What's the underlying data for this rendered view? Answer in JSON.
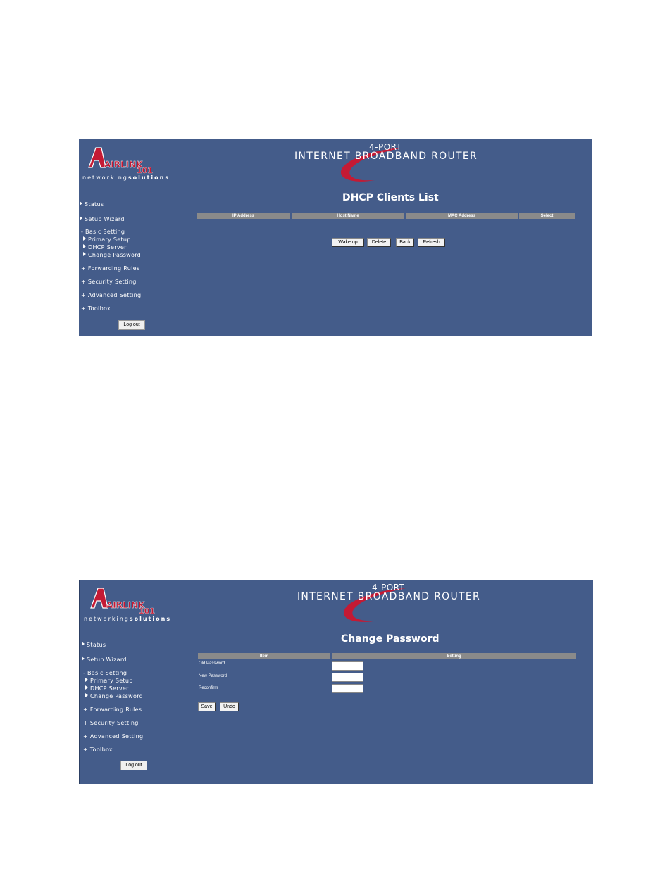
{
  "brand": {
    "logo_text": "AIRLINK",
    "logo_number": "101",
    "tagline_a": "networking",
    "tagline_b": "solutions",
    "router_top": "4-PORT",
    "router_main": "INTERNET BROADBAND ROUTER",
    "colors": {
      "panel": "#445c8a",
      "accent_red": "#c41a34",
      "header_gray": "#8a8a8a"
    }
  },
  "nav": {
    "status": "Status",
    "setup_wizard": "Setup Wizard",
    "basic_setting": "- Basic Setting",
    "primary_setup": "Primary Setup",
    "dhcp_server": "DHCP Server",
    "change_password": "Change Password",
    "forwarding_rules": "+ Forwarding Rules",
    "security_setting": "+ Security Setting",
    "advanced_setting": "+ Advanced Setting",
    "toolbox": "+ Toolbox",
    "logout": "Log out"
  },
  "dhcp_page": {
    "title": "DHCP Clients List",
    "columns": [
      "IP Address",
      "Host Name",
      "MAC Address",
      "Select"
    ],
    "buttons": {
      "wakeup": "Wake up",
      "delete": "Delete",
      "back": "Back",
      "refresh": "Refresh"
    }
  },
  "password_page": {
    "title": "Change Password",
    "columns": [
      "Item",
      "Setting"
    ],
    "fields": {
      "old": "Old Password",
      "new": "New Password",
      "reconfirm": "Reconfirm"
    },
    "buttons": {
      "save": "Save",
      "undo": "Undo"
    }
  }
}
